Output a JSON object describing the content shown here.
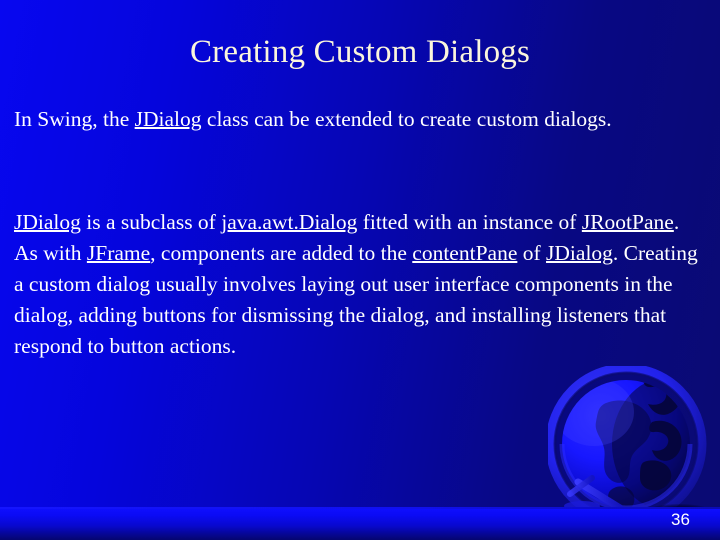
{
  "slide": {
    "title": "Creating Custom Dialogs",
    "page_number": "36",
    "background": {
      "gradient_from": "#0707F0",
      "gradient_to": "#0A0A72",
      "floor_band_color": "#0f0fff"
    },
    "title_color": "#FBF6DC",
    "body_color": "#FFFFFF"
  },
  "body": {
    "paragraph_1": {
      "segments": [
        {
          "text": "In Swing, the ",
          "underline": false
        },
        {
          "text": "JDialog",
          "underline": true
        },
        {
          "text": " class can be extended to create custom dialogs.",
          "underline": false
        }
      ],
      "plain": "In Swing, the JDialog class can be extended to create custom dialogs."
    },
    "paragraph_2": {
      "segments": [
        {
          "text": "JDialog",
          "underline": true
        },
        {
          "text": " is a subclass of ",
          "underline": false
        },
        {
          "text": "java.awt.Dialog",
          "underline": true
        },
        {
          "text": " fitted with an instance of ",
          "underline": false
        },
        {
          "text": "JRootPane",
          "underline": true
        },
        {
          "text": ". As with ",
          "underline": false
        },
        {
          "text": "JFrame",
          "underline": true
        },
        {
          "text": ", components are added to the ",
          "underline": false
        },
        {
          "text": "contentPane",
          "underline": true
        },
        {
          "text": " of ",
          "underline": false
        },
        {
          "text": "JDialog",
          "underline": true
        },
        {
          "text": ". Creating a custom dialog usually involves laying out user interface components in the dialog, adding buttons for dismissing the dialog, and installing listeners that respond to button actions.",
          "underline": false
        }
      ],
      "plain": "JDialog is a subclass of java.awt.Dialog fitted with an instance of JRootPane. As with JFrame, components are added to the contentPane of JDialog. Creating a custom dialog usually involves laying out user interface components in the dialog, adding buttons for dismissing the dialog, and installing listeners that respond to button actions."
    }
  },
  "decoration": {
    "globe_label": "globe-graphic"
  }
}
